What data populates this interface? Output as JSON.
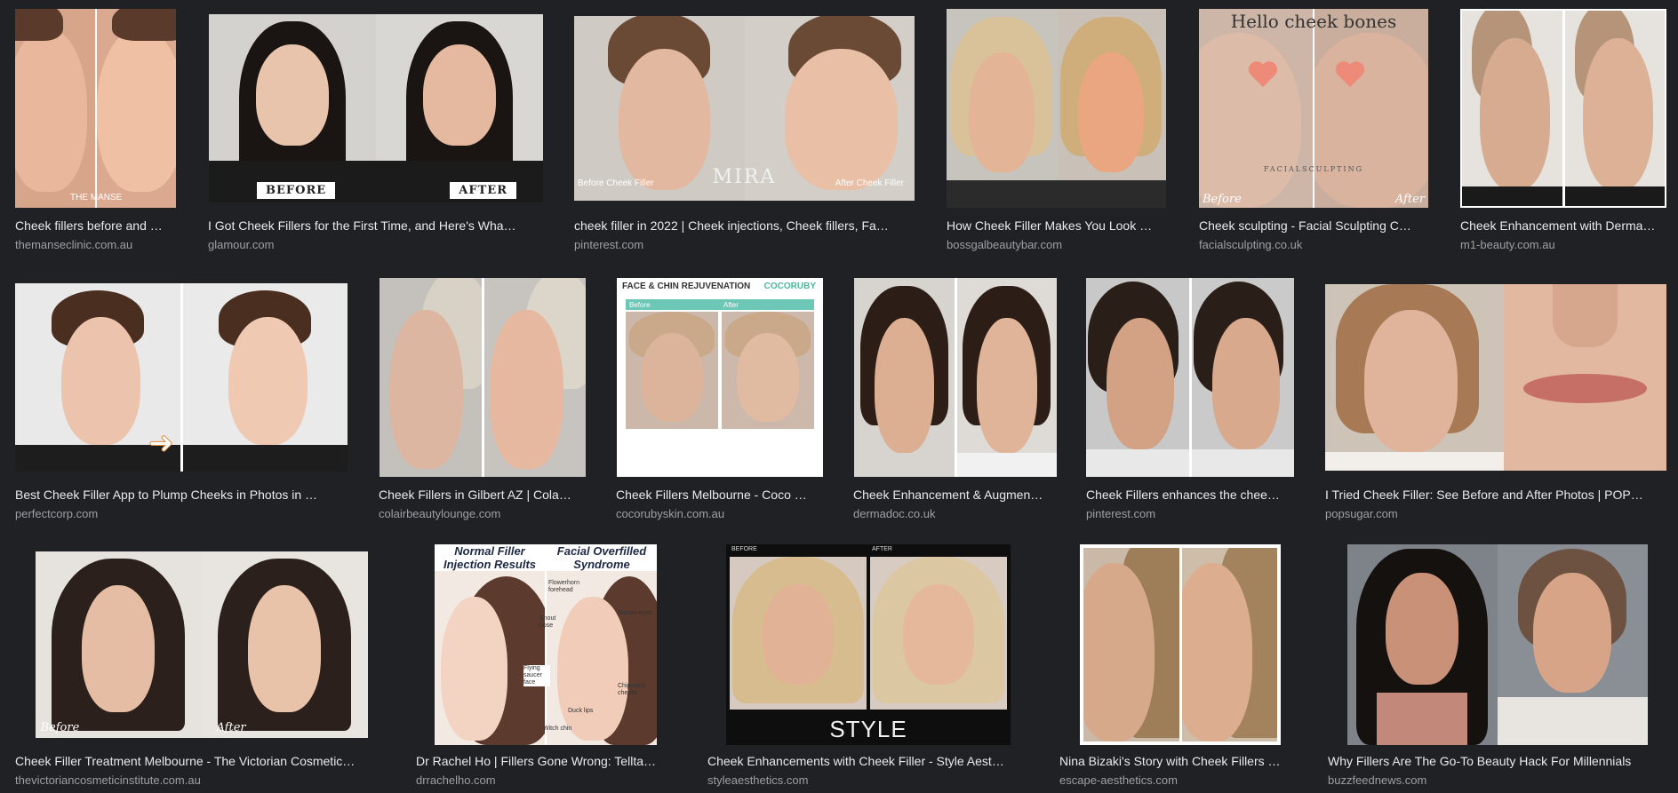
{
  "results": [
    {
      "title": "Cheek fillers before and …",
      "source": "themanseclinic.com.au",
      "captions": {
        "center": "THE MANSE"
      }
    },
    {
      "title": "I Got Cheek Fillers for the First Time, and Here's Wha…",
      "source": "glamour.com",
      "captions": {
        "before": "BEFORE",
        "after": "AFTER"
      }
    },
    {
      "title": "cheek filler in 2022 | Cheek injections, Cheek fillers, Fa…",
      "source": "pinterest.com",
      "captions": {
        "before": "Before Cheek Filler",
        "brand": "MIRA",
        "after": "After Cheek Filler"
      }
    },
    {
      "title": "How Cheek Filler Makes You Look …",
      "source": "bossgalbeautybar.com"
    },
    {
      "title": "Cheek sculpting - Facial Sculpting C…",
      "source": "facialsculpting.co.uk",
      "captions": {
        "heading": "Hello cheek bones",
        "brand": "FACIALSCULPTING",
        "before": "Before",
        "after": "After"
      }
    },
    {
      "title": "Cheek Enhancement with Derma…",
      "source": "m1-beauty.com.au"
    },
    {
      "title": "Best Cheek Filler App to Plump Cheeks in Photos in …",
      "source": "perfectcorp.com"
    },
    {
      "title": "Cheek Fillers in Gilbert AZ | Cola…",
      "source": "colairbeautylounge.com"
    },
    {
      "title": "Cheek Fillers Melbourne - Coco …",
      "source": "cocorubyskin.com.au",
      "captions": {
        "heading": "FACE & CHIN REJUVENATION",
        "logo": "COCORUBY",
        "before": "Before",
        "after": "After"
      }
    },
    {
      "title": "Cheek Enhancement & Augmen…",
      "source": "dermadoc.co.uk"
    },
    {
      "title": "Cheek Fillers enhances the chee…",
      "source": "pinterest.com"
    },
    {
      "title": "I Tried Cheek Filler: See Before and After Photos | POP…",
      "source": "popsugar.com"
    },
    {
      "title": "Cheek Filler Treatment Melbourne - The Victorian Cosmetic…",
      "source": "thevictoriancosmeticinstitute.com.au",
      "captions": {
        "before": "Before",
        "after": "After"
      }
    },
    {
      "title": "Dr Rachel Ho | Fillers Gone Wrong: Tellta…",
      "source": "drrachelho.com",
      "captions": {
        "left_heading": "Normal Filler Injection Results",
        "right_heading": "Facial Overfilled Syndrome",
        "labels": [
          "Flowerhorn forehead",
          "Sunset eyes",
          "Snout nose",
          "Flying saucer face",
          "Chipmunk cheeks",
          "Duck lips",
          "Witch chin"
        ]
      }
    },
    {
      "title": "Cheek Enhancements with Cheek Filler - Style Aest…",
      "source": "styleaesthetics.com",
      "captions": {
        "before": "BEFORE",
        "after": "AFTER",
        "brand": "STYLE"
      }
    },
    {
      "title": "Nina Bizaki's Story with Cheek Fillers …",
      "source": "escape-aesthetics.com"
    },
    {
      "title": "Why Fillers Are The Go-To Beauty Hack For Millennials",
      "source": "buzzfeednews.com"
    }
  ],
  "colors": {
    "background": "#202124",
    "title_text": "#e8eaed",
    "source_text": "#9aa0a6"
  }
}
